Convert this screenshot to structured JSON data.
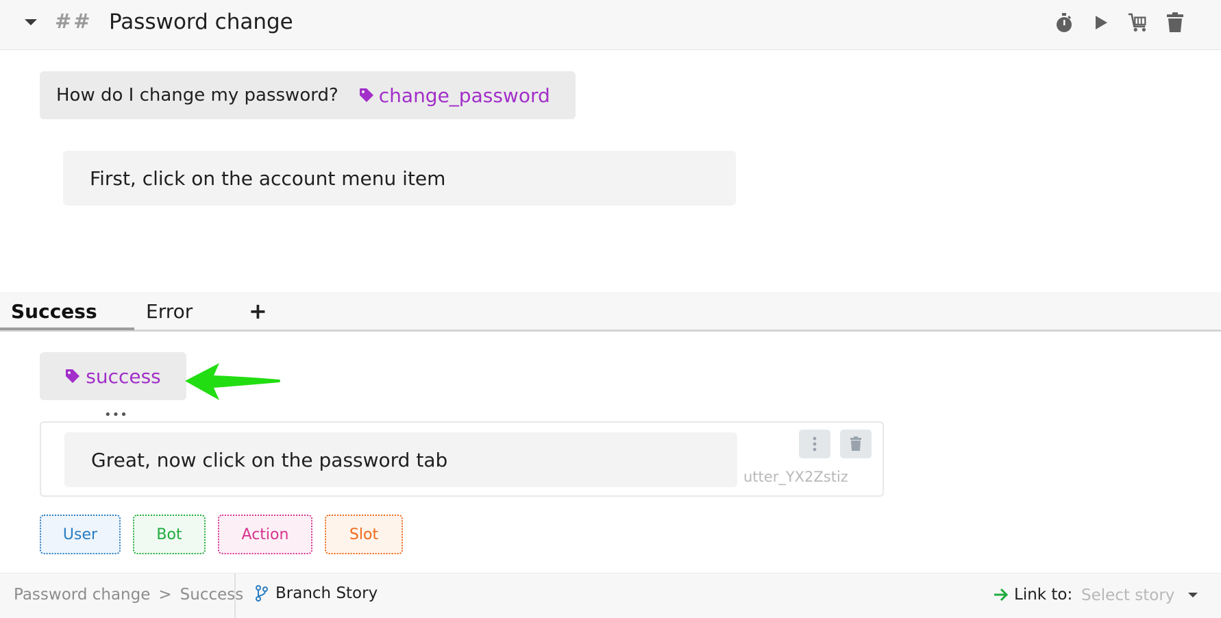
{
  "story": {
    "title": "Password change",
    "heading_marker": "##",
    "icons": [
      "stopwatch-icon",
      "play-icon",
      "cart-icon",
      "trash-icon"
    ]
  },
  "messages": {
    "user_text": "How do I change my password?",
    "user_intent": "change_password",
    "bot_text": "First, click on the account menu item"
  },
  "tabs": {
    "items": [
      "Success",
      "Error"
    ],
    "active": "Success",
    "add_label": "+"
  },
  "branch": {
    "intent": "success",
    "ellipsis": "•••",
    "bot_text": "Great, now click on the password tab",
    "response_name": "utter_YX2Zstiz"
  },
  "add_buttons": {
    "user": "User",
    "bot": "Bot",
    "action": "Action",
    "slot": "Slot"
  },
  "footer": {
    "breadcrumb": [
      "Password change",
      ">",
      "Success"
    ],
    "branch_label": "Branch Story",
    "link_label": "Link to:",
    "select_placeholder": "Select story"
  },
  "colors": {
    "intent": "#a22fc9",
    "user": "#2a7dc1",
    "bot": "#21ab3d",
    "action": "#d6348d",
    "slot": "#ee6a1c",
    "arrow": "#22dd11"
  }
}
